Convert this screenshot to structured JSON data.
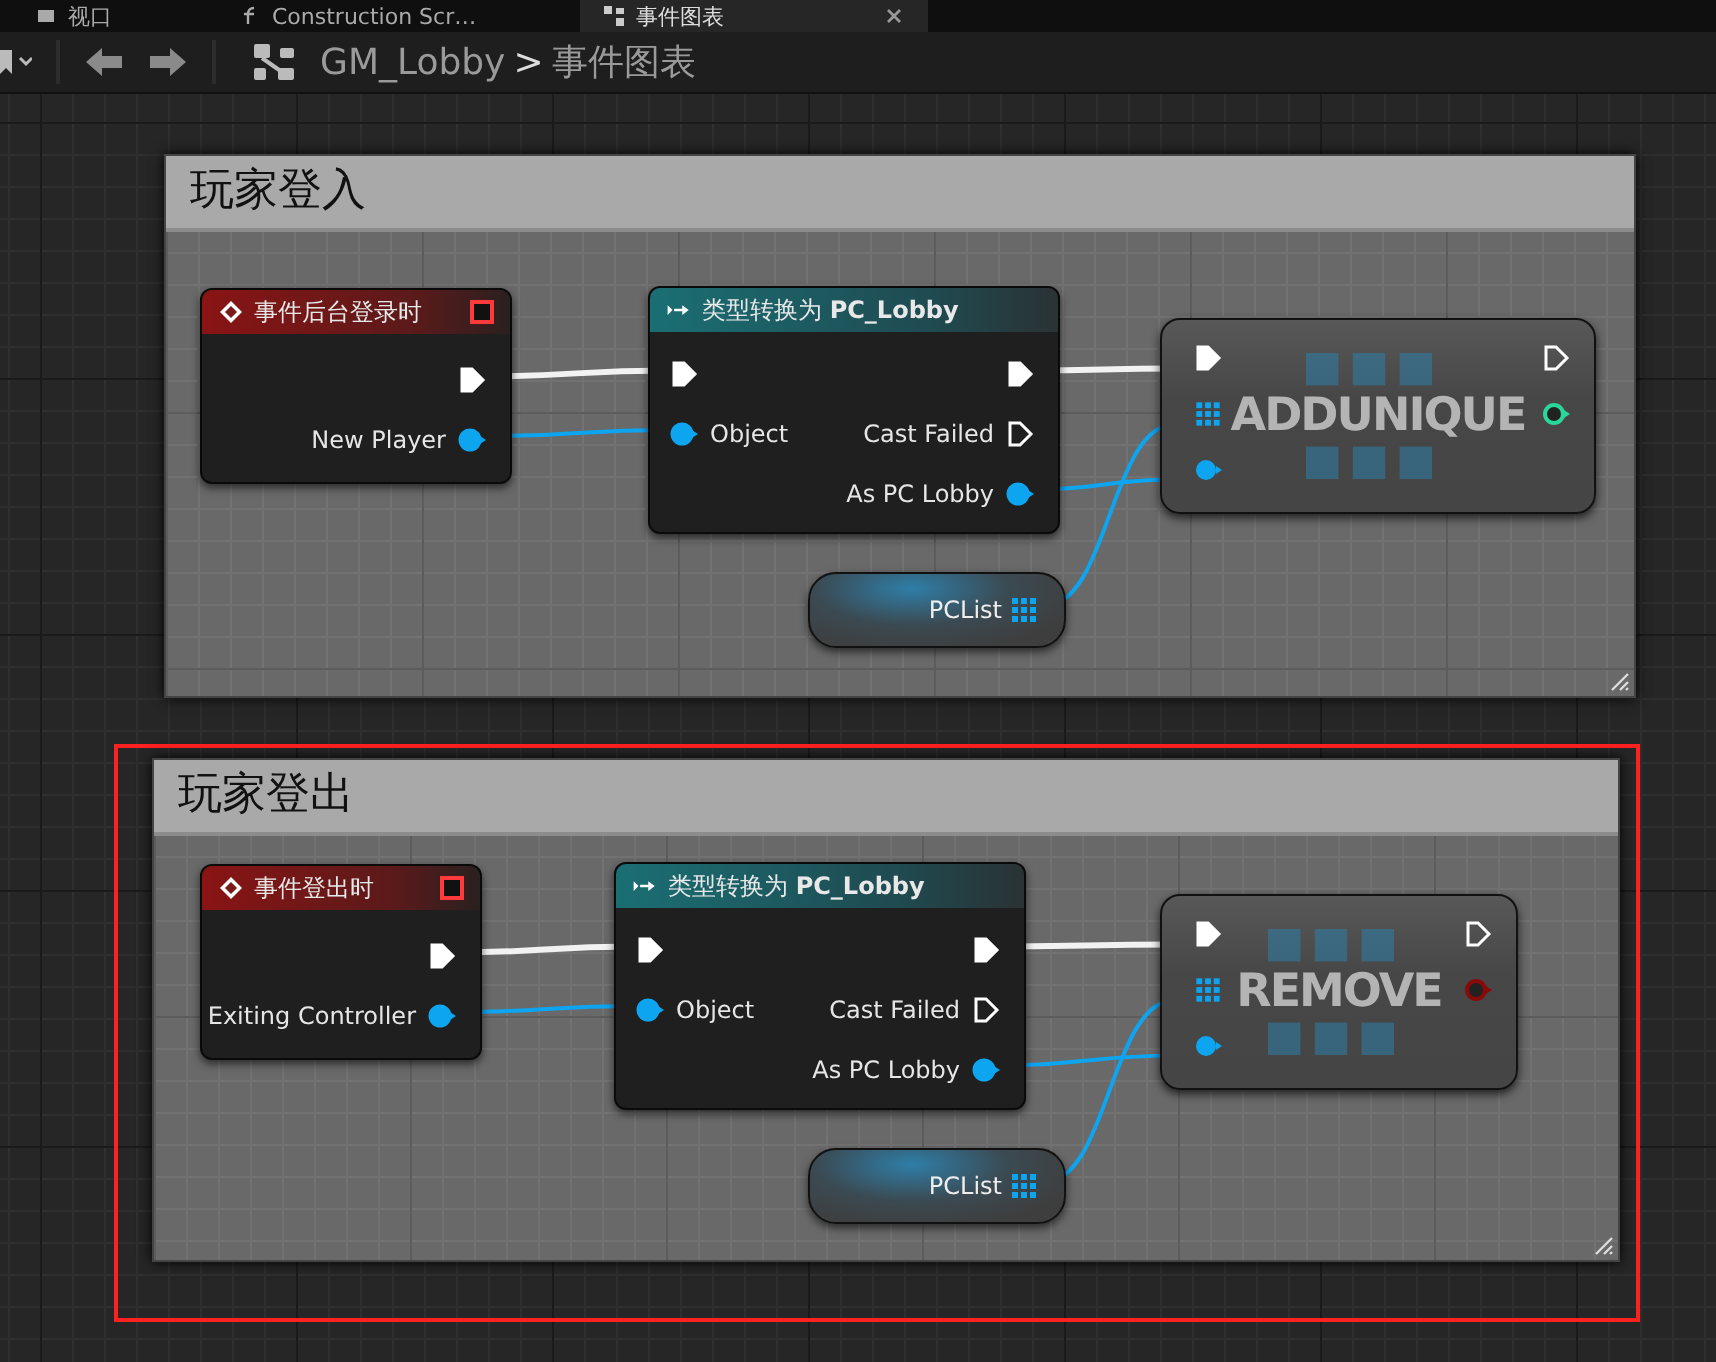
{
  "tabs": [
    {
      "label": "视口",
      "selected": false
    },
    {
      "label": "Construction Scr…",
      "selected": false
    },
    {
      "label": "事件图表",
      "selected": true
    }
  ],
  "breadcrumb": {
    "blueprint": "GM_Lobby",
    "separator": ">",
    "graph": "事件图表"
  },
  "comments": [
    {
      "title": "玩家登入",
      "highlighted": false,
      "event_node": {
        "title": "事件后台登录时",
        "pins": [
          {
            "kind": "exec",
            "connected": true
          },
          {
            "kind": "object",
            "label": "New Player",
            "connected": true
          }
        ]
      },
      "cast_node": {
        "title": "类型转换为 **PC_Lobby**",
        "inputs": [
          {
            "kind": "exec",
            "connected": true
          },
          {
            "kind": "object",
            "label": "Object",
            "connected": true
          }
        ],
        "outputs": [
          {
            "kind": "exec",
            "connected": true
          },
          {
            "kind": "exec",
            "label": "Cast Failed",
            "connected": false
          },
          {
            "kind": "object",
            "label": "As PC Lobby",
            "connected": true
          }
        ]
      },
      "variable_node": {
        "label": "PCList"
      },
      "function_node": {
        "title": "ADDUNIQUE",
        "return_pin": {
          "color": "#2bd69a"
        }
      }
    },
    {
      "title": "玩家登出",
      "highlighted": true,
      "event_node": {
        "title": "事件登出时",
        "pins": [
          {
            "kind": "exec",
            "connected": true
          },
          {
            "kind": "object",
            "label": "Exiting Controller",
            "connected": true
          }
        ]
      },
      "cast_node": {
        "title": "类型转换为 **PC_Lobby**",
        "inputs": [
          {
            "kind": "exec",
            "connected": true
          },
          {
            "kind": "object",
            "label": "Object",
            "connected": true
          }
        ],
        "outputs": [
          {
            "kind": "exec",
            "connected": true
          },
          {
            "kind": "exec",
            "label": "Cast Failed",
            "connected": false
          },
          {
            "kind": "object",
            "label": "As PC Lobby",
            "connected": true
          }
        ]
      },
      "variable_node": {
        "label": "PCList"
      },
      "function_node": {
        "title": "REMOVE",
        "return_pin": {
          "color": "#8a0a0a"
        }
      }
    }
  ]
}
